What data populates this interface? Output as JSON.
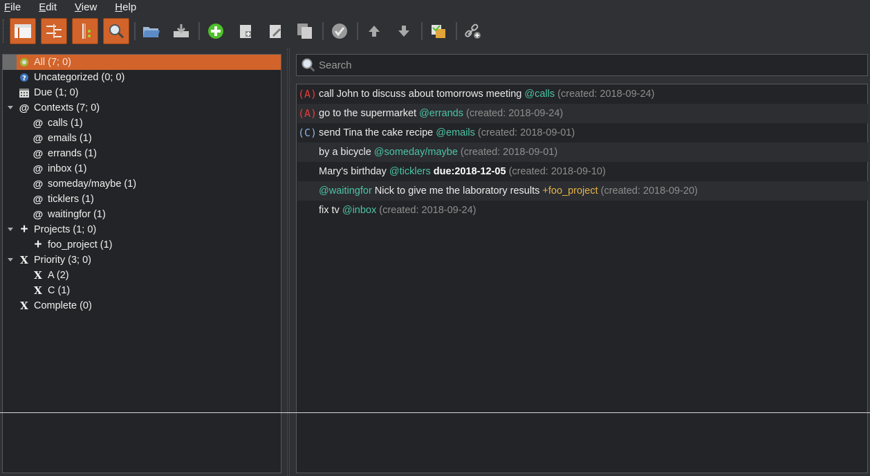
{
  "menu": [
    {
      "mnemonic": "F",
      "rest": "ile"
    },
    {
      "mnemonic": "E",
      "rest": "dit"
    },
    {
      "mnemonic": "V",
      "rest": "iew"
    },
    {
      "mnemonic": "H",
      "rest": "elp"
    }
  ],
  "toolbar": {
    "buttons": [
      "filters-panel-icon",
      "sort-icon",
      "view-options-icon",
      "search-toggle-icon",
      "open-icon",
      "save-icon",
      "add-task-icon",
      "new-subtask-icon",
      "edit-task-icon",
      "duplicate-task-icon",
      "complete-task-icon",
      "move-up-icon",
      "move-down-icon",
      "archive-icon",
      "link-icon"
    ],
    "accent": "#d2632a"
  },
  "filters": {
    "all": "All (7; 0)",
    "uncategorized": "Uncategorized (0; 0)",
    "due": "Due (1; 0)",
    "contexts": "Contexts (7; 0)",
    "context_items": [
      "calls (1)",
      "emails (1)",
      "errands (1)",
      "inbox (1)",
      "someday/maybe (1)",
      "ticklers (1)",
      "waitingfor (1)"
    ],
    "projects": "Projects (1; 0)",
    "project_items": [
      "foo_project (1)"
    ],
    "priority": "Priority (3; 0)",
    "priority_items": [
      "A (2)",
      "C (1)"
    ],
    "complete": "Complete (0)",
    "at_glyph": "@",
    "plus_glyph": "+",
    "x_glyph": "X"
  },
  "search": {
    "placeholder": "Search"
  },
  "tasks": [
    {
      "prio": "(A)",
      "pre": "call John to discuss about tomorrows meeting ",
      "ctx": "@calls",
      "mid": "",
      "proj": "",
      "due": "",
      "meta": " (created: 2018-09-24)"
    },
    {
      "prio": "(A)",
      "pre": "go to the supermarket ",
      "ctx": "@errands",
      "mid": "",
      "proj": "",
      "due": "",
      "meta": " (created: 2018-09-24)"
    },
    {
      "prio": "(C)",
      "pre": "send Tina the cake recipe ",
      "ctx": "@emails",
      "mid": "",
      "proj": "",
      "due": "",
      "meta": " (created: 2018-09-01)"
    },
    {
      "prio": "",
      "pre": "by a bicycle ",
      "ctx": "@someday/maybe",
      "mid": "",
      "proj": "",
      "due": "",
      "meta": " (created: 2018-09-01)"
    },
    {
      "prio": "",
      "pre": "Mary's birthday ",
      "ctx": "@ticklers",
      "mid": " ",
      "proj": "",
      "due": "due:2018-12-05",
      "meta": " (created: 2018-09-10)"
    },
    {
      "prio": "",
      "pre": "",
      "ctx": "@waitingfor",
      "mid": " Nick to give me the laboratory results ",
      "proj": "+foo_project",
      "due": "",
      "meta": " (created: 2018-09-20)"
    },
    {
      "prio": "",
      "pre": "fix tv ",
      "ctx": "@inbox",
      "mid": "",
      "proj": "",
      "due": "",
      "meta": " (created: 2018-09-24)"
    }
  ]
}
